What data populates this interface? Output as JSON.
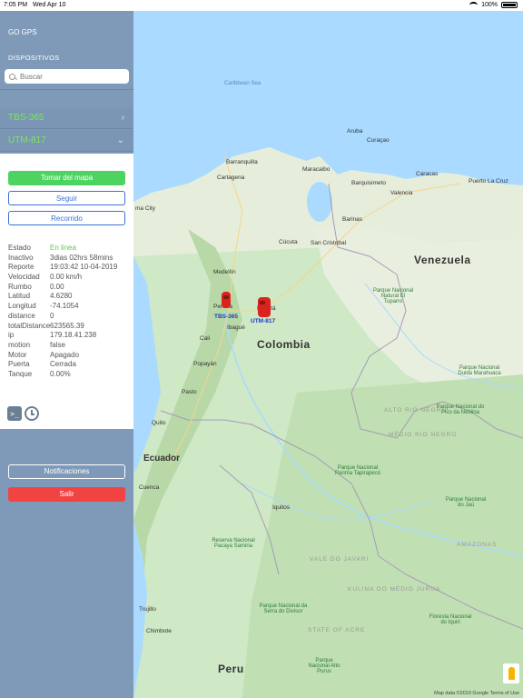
{
  "status_bar": {
    "time": "7:05 PM",
    "date": "Wed Apr 10",
    "battery": "100%"
  },
  "app": {
    "title": "GO GPS"
  },
  "sidebar": {
    "section_label": "DISPOSITIVOS",
    "search_placeholder": "Buscar",
    "devices": [
      {
        "label": "TBS-365",
        "chevron": "›"
      },
      {
        "label": "UTM-817",
        "chevron": "⌄"
      }
    ],
    "actions": {
      "take_map": "Tomar del mapa",
      "follow": "Seguir",
      "route": "Recorrido"
    },
    "details": [
      {
        "key": "Estado",
        "value": "En linea"
      },
      {
        "key": "Inactivo",
        "value": "3dias 02hrs 58mins"
      },
      {
        "key": "Reporte",
        "value": "19:03:42 10-04-2019"
      },
      {
        "key": "Velocidad",
        "value": "0.00 km/h"
      },
      {
        "key": "Rumbo",
        "value": "0.00"
      },
      {
        "key": "Latitud",
        "value": "4.6280"
      },
      {
        "key": "Longitud",
        "value": "-74.1054"
      },
      {
        "key": "distance",
        "value": "0"
      },
      {
        "key": "totalDistance",
        "value": "623565.39"
      },
      {
        "key": "ip",
        "value": "179.18.41.238"
      },
      {
        "key": "motion",
        "value": "false"
      },
      {
        "key": "Motor",
        "value": "Apagado"
      },
      {
        "key": "Puerta",
        "value": "Cerrada"
      },
      {
        "key": "Tanque",
        "value": "0.00%"
      }
    ],
    "tool_icons": [
      "terminal-icon",
      "clock-icon"
    ],
    "notifications": "Notificaciones",
    "logout": "Salir"
  },
  "map": {
    "markers": [
      {
        "label": "TBS-365"
      },
      {
        "label": "UTM-817"
      }
    ],
    "labels": {
      "caribbean": "Caribbean Sea",
      "aruba": "Aruba",
      "curacao": "Curaçao",
      "barranquilla": "Barranquilla",
      "cartagena": "Cartagena",
      "maracaibo": "Maracaibo",
      "caracas": "Caracas",
      "barquisimeto": "Barquisimeto",
      "valencia": "Valencia",
      "puerto_la_cruz": "Puerto La Cruz",
      "panama_city": "ma City",
      "cucuta": "Cúcuta",
      "san_cristobal": "San Cristobal",
      "barinas": "Barinas",
      "medellin": "Medellín",
      "bogota": "Bogotá",
      "ibague": "Ibagué",
      "pereira": "Pereira",
      "cali": "Cali",
      "popayan": "Popayán",
      "pasto": "Pasto",
      "quito": "Quito",
      "cuenca": "Cuenca",
      "iquitos": "Iquitos",
      "trujillo": "Trujillo",
      "chimbote": "Chimbote",
      "venezuela": "Venezuela",
      "colombia": "Colombia",
      "ecuador": "Ecuador",
      "peru": "Peru",
      "amazonas": "AMAZONAS",
      "acre": "STATE OF ACRE",
      "javari": "VALE DO JAVARI",
      "alto_rio_negro": "ALTO RIO NEGRO",
      "medio_rio_negro": "MÉDIO RIO NEGRO",
      "kulina": "KULINA DO MÉDIO JURUA",
      "park_tuparro": "Parque Nacional Natural El Tuparro",
      "park_neblina": "Parque Nacional do Pico da Neblina",
      "park_duida": "Parque Nacional Duida Marahuaca",
      "park_duida_short": "Parque Nacional Parima Tapirapecó",
      "park_jau": "Parque Nacional do Jaú",
      "park_pacaya": "Reserva Nacional Pacaya Samiria",
      "park_serra": "Parque Nacional da Serra do Divisor",
      "park_alto_purus": "Parque Nacional Alto Purus",
      "park_iquiri": "Floresta Nacional do Iquiri"
    },
    "footer": "Map data ©2019 Google   Terms of Use",
    "google": ""
  },
  "colors": {
    "sidebar": "#7f9ab8",
    "online": "#5dc95d",
    "accent": "#3a6fd8",
    "danger": "#f24343",
    "device_label": "#7ee35a"
  }
}
